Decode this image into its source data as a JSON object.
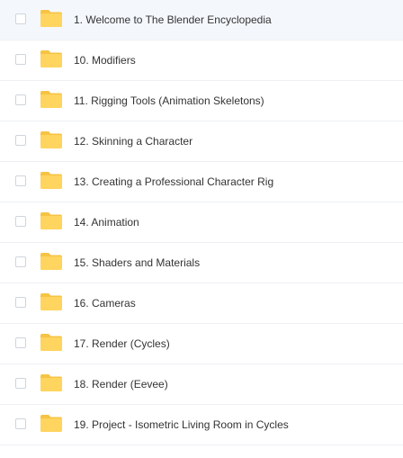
{
  "icons": {
    "folder": "folder-icon",
    "checkbox": "checkbox-unchecked"
  },
  "colors": {
    "folder_body": "#ffd45f",
    "folder_tab": "#f6c343",
    "row_highlight": "#f4f8fd",
    "text": "#333333"
  },
  "file_list": {
    "items": [
      {
        "name": "1. Welcome to The Blender Encyclopedia",
        "checked": false
      },
      {
        "name": "10. Modifiers",
        "checked": false
      },
      {
        "name": "11. Rigging Tools (Animation Skeletons)",
        "checked": false
      },
      {
        "name": "12. Skinning a Character",
        "checked": false
      },
      {
        "name": "13. Creating a Professional Character Rig",
        "checked": false
      },
      {
        "name": "14. Animation",
        "checked": false
      },
      {
        "name": "15. Shaders and Materials",
        "checked": false
      },
      {
        "name": "16. Cameras",
        "checked": false
      },
      {
        "name": "17. Render (Cycles)",
        "checked": false
      },
      {
        "name": "18. Render (Eevee)",
        "checked": false
      },
      {
        "name": "19. Project - Isometric Living Room in Cycles",
        "checked": false
      }
    ]
  }
}
